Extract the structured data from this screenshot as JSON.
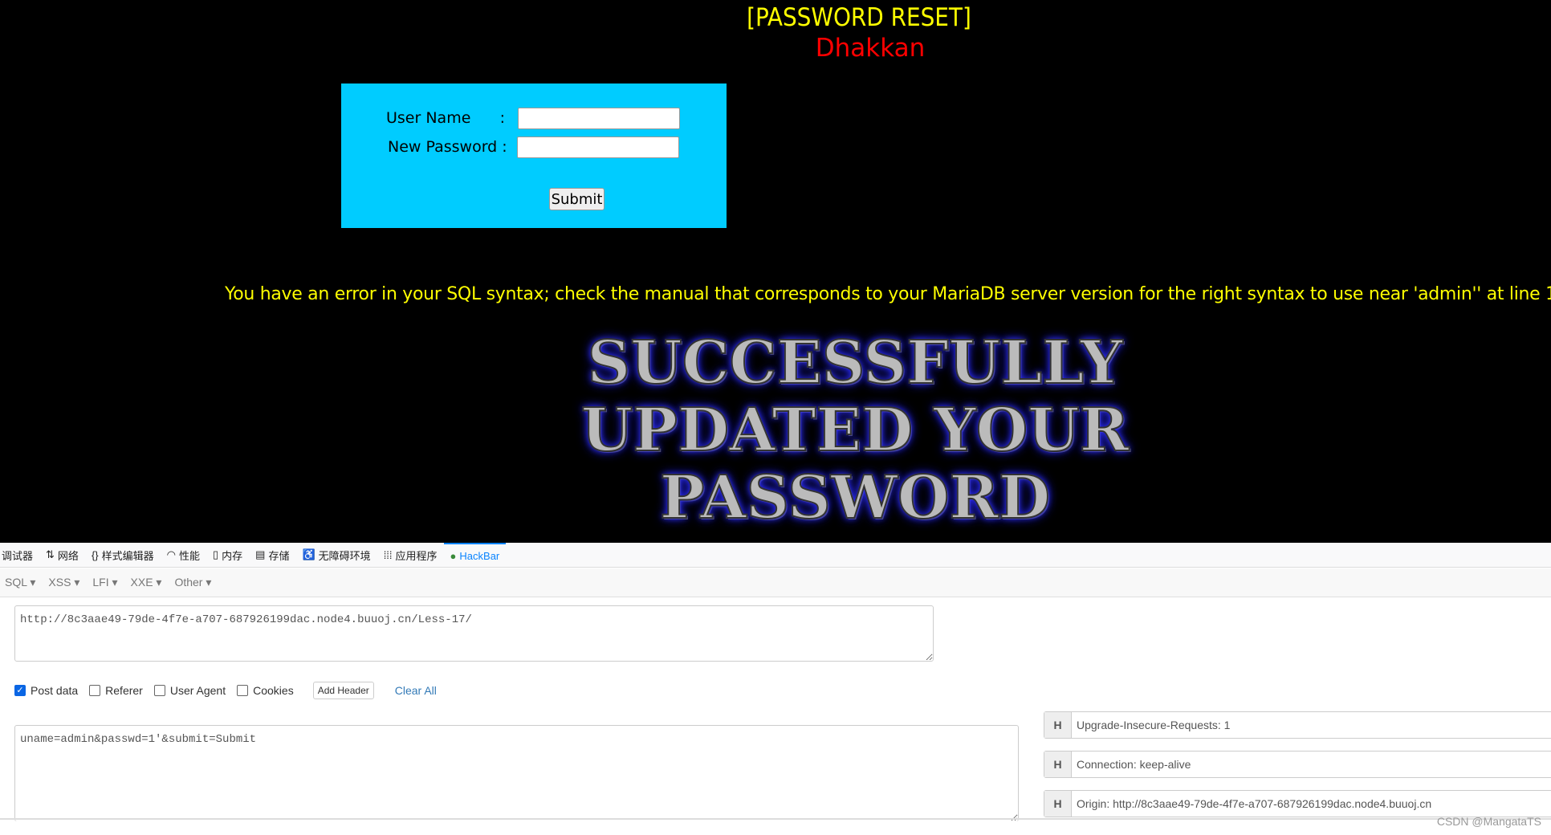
{
  "page": {
    "title": "[PASSWORD RESET]",
    "subtitle": "Dhakkan",
    "form": {
      "username_label": "User Name      :",
      "password_label": "New Password :",
      "submit_label": "Submit"
    },
    "error": "You have an error in your SQL syntax; check the manual that corresponds to your MariaDB server version for the right syntax to use near 'admin'' at line 1",
    "success_image_text": "SUCCESSFULLY UPDATED YOUR PASSWORD"
  },
  "devtools": {
    "tabs": [
      {
        "label": "调试器",
        "icon": ""
      },
      {
        "label": "网络",
        "icon": "⇅"
      },
      {
        "label": "样式编辑器",
        "icon": "{}"
      },
      {
        "label": "性能",
        "icon": "◠"
      },
      {
        "label": "内存",
        "icon": "▯"
      },
      {
        "label": "存储",
        "icon": "▤"
      },
      {
        "label": "无障碍环境",
        "icon": "♿"
      },
      {
        "label": "应用程序",
        "icon": "⁞⁞⁞"
      },
      {
        "label": "HackBar",
        "icon": "●"
      }
    ],
    "active": "HackBar"
  },
  "hackbar": {
    "menu": [
      "SQL ▾",
      "XSS ▾",
      "LFI ▾",
      "XXE ▾",
      "Other ▾"
    ],
    "url": "http://8c3aae49-79de-4f7e-a707-687926199dac.node4.buuoj.cn/Less-17/",
    "options": [
      {
        "label": "Post data",
        "checked": true
      },
      {
        "label": "Referer",
        "checked": false
      },
      {
        "label": "User Agent",
        "checked": false
      },
      {
        "label": "Cookies",
        "checked": false
      }
    ],
    "add_header": "Add Header",
    "clear_all": "Clear All",
    "post_data": "uname=admin&passwd=1'&submit=Submit",
    "headers": [
      {
        "tag": "H",
        "value": "Upgrade-Insecure-Requests: 1"
      },
      {
        "tag": "H",
        "value": "Connection: keep-alive"
      },
      {
        "tag": "H",
        "value": "Origin: http://8c3aae49-79de-4f7e-a707-687926199dac.node4.buuoj.cn"
      }
    ]
  },
  "watermark": "CSDN @MangataTS",
  "colors": {
    "form_bg": "#00ccff",
    "title": "#ffff00",
    "subtitle": "#ff0000",
    "accent": "#0a84ff"
  }
}
